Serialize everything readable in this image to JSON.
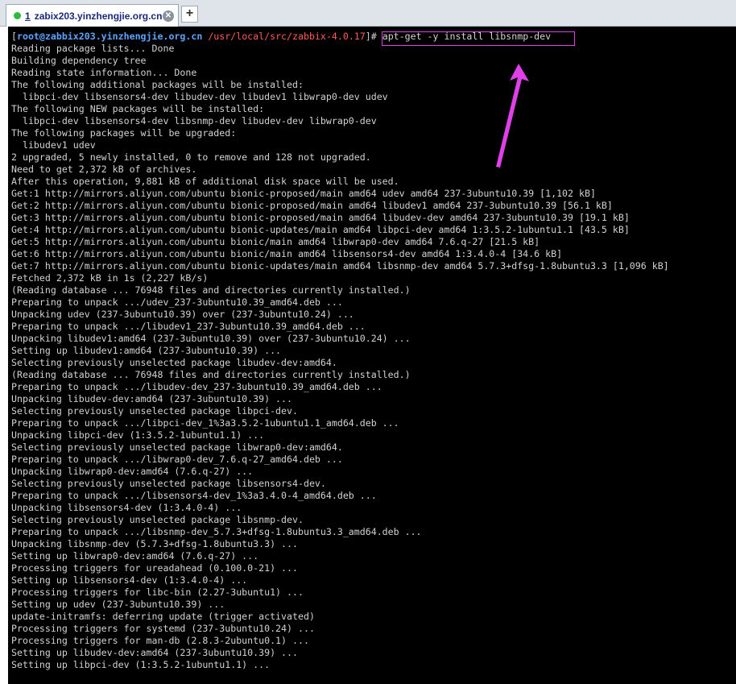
{
  "tab": {
    "number": "1",
    "title": "zabix203.yinzhengjie.org.cn",
    "status_color": "#2dbb3a",
    "close_icon": "close-icon",
    "add_icon": "plus-icon"
  },
  "prompt": {
    "open": "[",
    "user_host": "root@zabbix203.yinzhengjie.org.cn",
    "path": "/usr/local/src/zabbix-4.0.17",
    "close": "]",
    "symbol": "# ",
    "command": "apt-get -y install libsnmp-dev"
  },
  "highlight_color": "#e040e8",
  "output_lines": [
    "Reading package lists... Done",
    "Building dependency tree",
    "Reading state information... Done",
    "The following additional packages will be installed:",
    "  libpci-dev libsensors4-dev libudev-dev libudev1 libwrap0-dev udev",
    "The following NEW packages will be installed:",
    "  libpci-dev libsensors4-dev libsnmp-dev libudev-dev libwrap0-dev",
    "The following packages will be upgraded:",
    "  libudev1 udev",
    "2 upgraded, 5 newly installed, 0 to remove and 128 not upgraded.",
    "Need to get 2,372 kB of archives.",
    "After this operation, 9,881 kB of additional disk space will be used.",
    "Get:1 http://mirrors.aliyun.com/ubuntu bionic-proposed/main amd64 udev amd64 237-3ubuntu10.39 [1,102 kB]",
    "Get:2 http://mirrors.aliyun.com/ubuntu bionic-proposed/main amd64 libudev1 amd64 237-3ubuntu10.39 [56.1 kB]",
    "Get:3 http://mirrors.aliyun.com/ubuntu bionic-proposed/main amd64 libudev-dev amd64 237-3ubuntu10.39 [19.1 kB]",
    "Get:4 http://mirrors.aliyun.com/ubuntu bionic-updates/main amd64 libpci-dev amd64 1:3.5.2-1ubuntu1.1 [43.5 kB]",
    "Get:5 http://mirrors.aliyun.com/ubuntu bionic/main amd64 libwrap0-dev amd64 7.6.q-27 [21.5 kB]",
    "Get:6 http://mirrors.aliyun.com/ubuntu bionic/main amd64 libsensors4-dev amd64 1:3.4.0-4 [34.6 kB]",
    "Get:7 http://mirrors.aliyun.com/ubuntu bionic-updates/main amd64 libsnmp-dev amd64 5.7.3+dfsg-1.8ubuntu3.3 [1,096 kB]",
    "Fetched 2,372 kB in 1s (2,227 kB/s)",
    "(Reading database ... 76948 files and directories currently installed.)",
    "Preparing to unpack .../udev_237-3ubuntu10.39_amd64.deb ...",
    "Unpacking udev (237-3ubuntu10.39) over (237-3ubuntu10.24) ...",
    "Preparing to unpack .../libudev1_237-3ubuntu10.39_amd64.deb ...",
    "Unpacking libudev1:amd64 (237-3ubuntu10.39) over (237-3ubuntu10.24) ...",
    "Setting up libudev1:amd64 (237-3ubuntu10.39) ...",
    "Selecting previously unselected package libudev-dev:amd64.",
    "(Reading database ... 76948 files and directories currently installed.)",
    "Preparing to unpack .../libudev-dev_237-3ubuntu10.39_amd64.deb ...",
    "Unpacking libudev-dev:amd64 (237-3ubuntu10.39) ...",
    "Selecting previously unselected package libpci-dev.",
    "Preparing to unpack .../libpci-dev_1%3a3.5.2-1ubuntu1.1_amd64.deb ...",
    "Unpacking libpci-dev (1:3.5.2-1ubuntu1.1) ...",
    "Selecting previously unselected package libwrap0-dev:amd64.",
    "Preparing to unpack .../libwrap0-dev_7.6.q-27_amd64.deb ...",
    "Unpacking libwrap0-dev:amd64 (7.6.q-27) ...",
    "Selecting previously unselected package libsensors4-dev.",
    "Preparing to unpack .../libsensors4-dev_1%3a3.4.0-4_amd64.deb ...",
    "Unpacking libsensors4-dev (1:3.4.0-4) ...",
    "Selecting previously unselected package libsnmp-dev.",
    "Preparing to unpack .../libsnmp-dev_5.7.3+dfsg-1.8ubuntu3.3_amd64.deb ...",
    "Unpacking libsnmp-dev (5.7.3+dfsg-1.8ubuntu3.3) ...",
    "Setting up libwrap0-dev:amd64 (7.6.q-27) ...",
    "Processing triggers for ureadahead (0.100.0-21) ...",
    "Setting up libsensors4-dev (1:3.4.0-4) ...",
    "Processing triggers for libc-bin (2.27-3ubuntu1) ...",
    "Setting up udev (237-3ubuntu10.39) ...",
    "update-initramfs: deferring update (trigger activated)",
    "Processing triggers for systemd (237-3ubuntu10.24) ...",
    "Processing triggers for man-db (2.8.3-2ubuntu0.1) ...",
    "Setting up libudev-dev:amd64 (237-3ubuntu10.39) ...",
    "Setting up libpci-dev (1:3.5.2-1ubuntu1.1) ..."
  ]
}
